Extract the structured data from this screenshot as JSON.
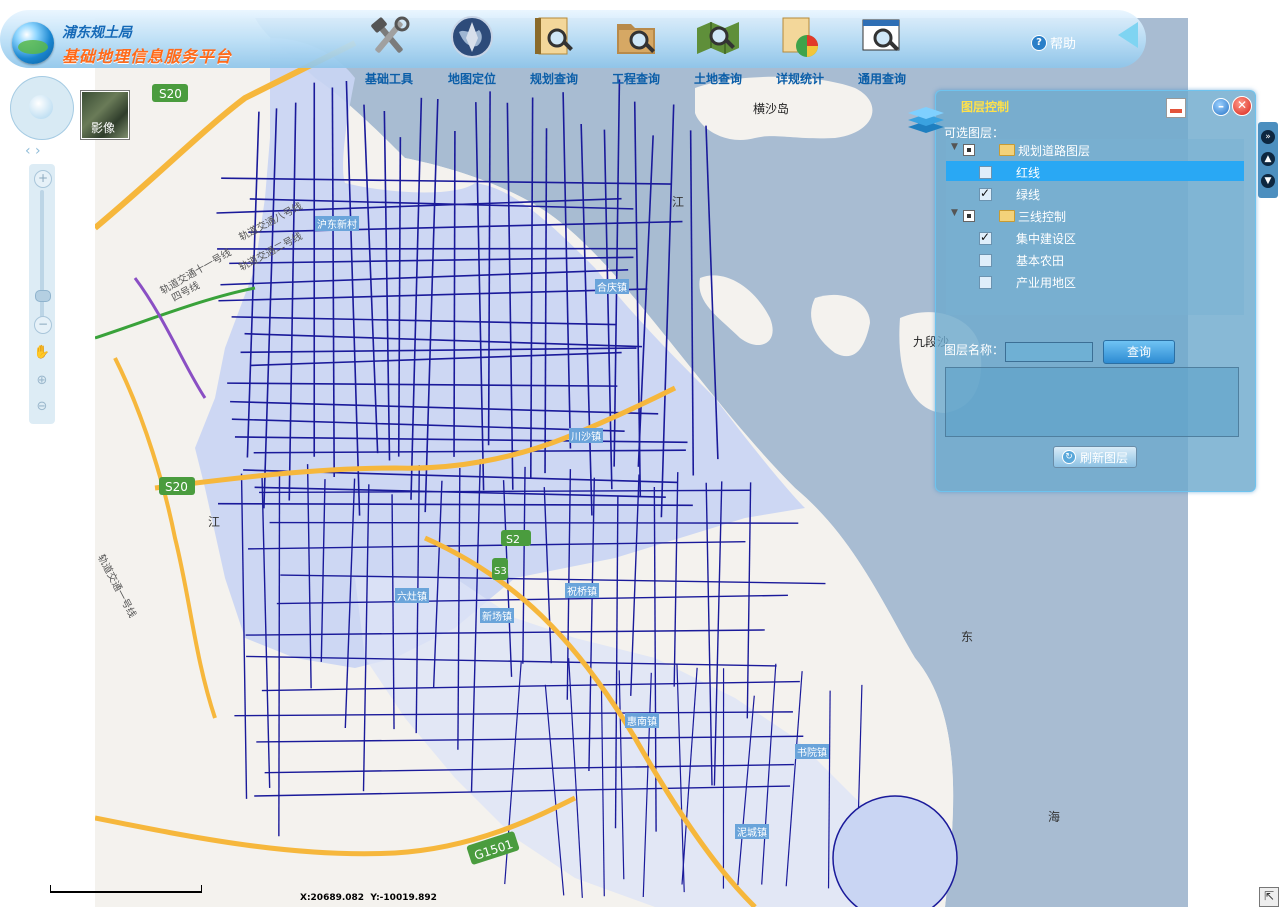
{
  "header": {
    "org_name": "浦东规土局",
    "platform_name": "基础地理信息服务平台",
    "help_label": "帮助"
  },
  "toolbar": [
    {
      "label": "基础工具",
      "icon": "tools-icon"
    },
    {
      "label": "地图定位",
      "icon": "globe-locate-icon"
    },
    {
      "label": "规划查询",
      "icon": "planning-search-icon"
    },
    {
      "label": "工程查询",
      "icon": "project-search-icon"
    },
    {
      "label": "土地查询",
      "icon": "land-search-icon"
    },
    {
      "label": "详规统计",
      "icon": "statistics-icon"
    },
    {
      "label": "通用查询",
      "icon": "general-search-icon"
    }
  ],
  "map": {
    "imagery_toggle": "影像",
    "place_labels": [
      "横沙岛",
      "江",
      "九段沙",
      "东",
      "海",
      "江"
    ],
    "road_shields": [
      "S20",
      "S20",
      "G1501",
      "S2",
      "S3"
    ],
    "town_labels": [
      "沪东新村",
      "合庆镇",
      "川沙镇",
      "祝桥镇",
      "六灶镇",
      "惠南镇",
      "书院镇",
      "泥城镇",
      "新场镇"
    ],
    "metro_labels": [
      "轨道交通八号线",
      "轨道交通二号线",
      "四号线",
      "轨道交通十一号线",
      "轨道交通一号线"
    ],
    "coordinates": {
      "x": "X:20689.082",
      "y": "Y:-10019.892"
    }
  },
  "layer_panel": {
    "title": "图层控制",
    "optional_label": "可选图层：",
    "groups": [
      {
        "name": "规划道路图层",
        "items": [
          {
            "label": "红线",
            "checked": false,
            "selected": true
          },
          {
            "label": "绿线",
            "checked": true,
            "selected": false
          }
        ]
      },
      {
        "name": "三线控制",
        "items": [
          {
            "label": "集中建设区",
            "checked": true,
            "selected": false
          },
          {
            "label": "基本农田",
            "checked": false,
            "selected": false
          },
          {
            "label": "产业用地区",
            "checked": false,
            "selected": false
          }
        ]
      }
    ],
    "name_label": "图层名称：",
    "name_value": "",
    "query_label": "查询",
    "refresh_label": "刷新图层"
  },
  "colors": {
    "accent": "#29a8f4",
    "title_orange": "#ff6a1a",
    "panel_title": "#ffe14a",
    "road_blue": "#1a1a9a",
    "sea": "#a9bdd2",
    "district": "#c9d5f3"
  }
}
